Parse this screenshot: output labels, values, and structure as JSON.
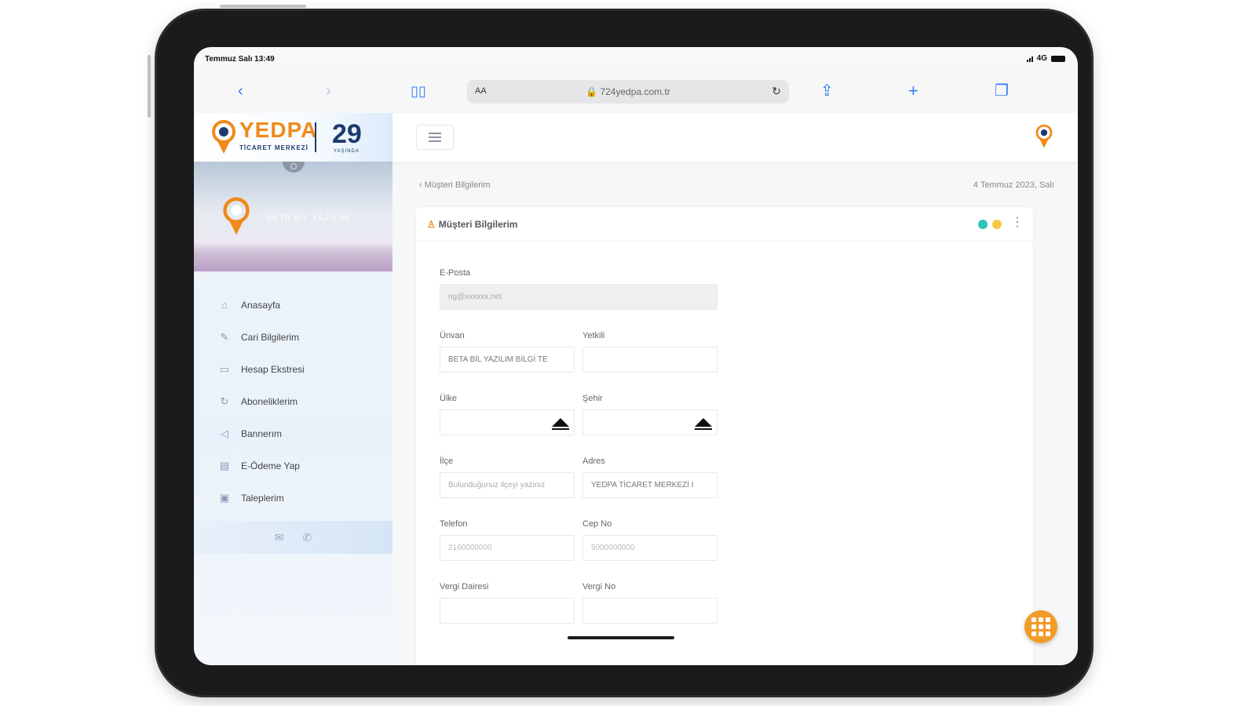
{
  "status": {
    "time": "Temmuz Salı 13:49",
    "network": "4G"
  },
  "browser": {
    "text_size_label": "AA",
    "url": "724yedpa.com.tr"
  },
  "brand": {
    "name": "YEDPA",
    "subtitle": "TİCARET MERKEZİ",
    "anniversary": "29",
    "anniversary_sub": "YAŞINDA",
    "company_short": "BETA BİL YAZILIM"
  },
  "sidebar": {
    "items": [
      {
        "label": "Anasayfa",
        "icon": "home-icon"
      },
      {
        "label": "Cari Bilgilerim",
        "icon": "pen-icon"
      },
      {
        "label": "Hesap Ekstresi",
        "icon": "card-icon"
      },
      {
        "label": "Aboneliklerim",
        "icon": "refresh-icon"
      },
      {
        "label": "Bannerım",
        "icon": "megaphone-icon"
      },
      {
        "label": "E-Ödeme Yap",
        "icon": "credit-card-icon"
      },
      {
        "label": "Taleplerim",
        "icon": "briefcase-icon"
      }
    ]
  },
  "breadcrumb": {
    "back": "‹",
    "label": "Müşteri Bilgilerim",
    "date": "4 Temmuz 2023, Salı"
  },
  "card": {
    "title": "Müşteri Bilgilerim"
  },
  "form": {
    "email": {
      "label": "E-Posta",
      "value": "ng@xxxxxx.net"
    },
    "unvan": {
      "label": "Ünvan",
      "value": "BETA BİL YAZILIM BİLGİ TE"
    },
    "yetkili": {
      "label": "Yetkili",
      "value": ""
    },
    "ulke": {
      "label": "Ülke",
      "value": ""
    },
    "sehir": {
      "label": "Şehir",
      "value": ""
    },
    "ilce": {
      "label": "İlçe",
      "value": "Bulunduğunuz ilçeyi yazınız"
    },
    "adres": {
      "label": "Adres",
      "value": "YEDPA TİCARET MERKEZİ I"
    },
    "telefon": {
      "label": "Telefon",
      "value": "2160000000"
    },
    "cep": {
      "label": "Cep No",
      "value": "5000000000"
    },
    "vergi_dairesi": {
      "label": "Vergi Dairesi",
      "value": ""
    },
    "vergi_no": {
      "label": "Vergi No",
      "value": ""
    }
  },
  "colors": {
    "accent": "#f08a1c",
    "navy": "#1e3a6e",
    "status_teal": "#2ec4b6",
    "status_yellow": "#f7c948",
    "fab": "#f39b2a"
  }
}
